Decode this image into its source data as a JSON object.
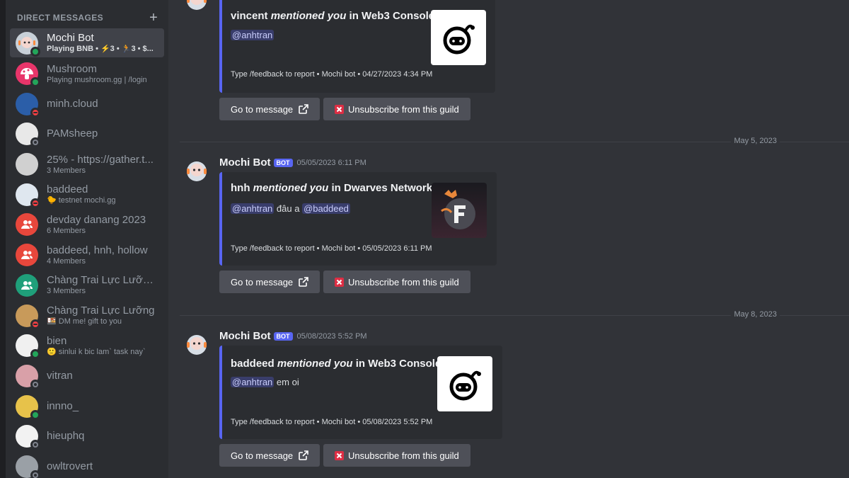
{
  "sidebar": {
    "header": "DIRECT MESSAGES",
    "items": [
      {
        "name": "Mochi Bot",
        "sub": "Playing BNB • ⚡3 • 🏃3 • $...",
        "status": "online",
        "avatar": "mochi-bot-avatar",
        "color": "#c8d0d8"
      },
      {
        "name": "Mushroom",
        "sub": "Playing mushroom.gg | /login",
        "status": "online",
        "avatar": "mushroom-avatar",
        "color": "#e8356a"
      },
      {
        "name": "minh.cloud",
        "sub": "",
        "status": "dnd",
        "avatar": "minh-avatar",
        "color": "#2b5ea8"
      },
      {
        "name": "PAMsheep",
        "sub": "",
        "status": "offline",
        "avatar": "pamsheep-avatar",
        "color": "#e8e8e8"
      },
      {
        "name": "25% - https://gather.t...",
        "sub": "3 Members",
        "status": "none",
        "avatar": "group-photo-avatar",
        "color": "#d0d0d0"
      },
      {
        "name": "baddeed",
        "sub": "🐤 testnet mochi.gg",
        "status": "dnd",
        "avatar": "baddeed-avatar",
        "color": "#dfe7ef"
      },
      {
        "name": "devday danang 2023",
        "sub": "6 Members",
        "status": "none",
        "avatar": "group-icon",
        "color": "#e8473c"
      },
      {
        "name": "baddeed, hnh, hollow",
        "sub": "4 Members",
        "status": "none",
        "avatar": "group-icon",
        "color": "#e8473c"
      },
      {
        "name": "Chàng Trai Lực Lưỡng,...",
        "sub": "3 Members",
        "status": "none",
        "avatar": "group-icon",
        "color": "#1f9f7a"
      },
      {
        "name": "Chàng Trai Lực Lưỡng",
        "sub": "🍱 DM me! gift to you",
        "status": "dnd",
        "avatar": "doge-avatar",
        "color": "#c89a5a"
      },
      {
        "name": "bien",
        "sub": "🙂 sinlui k bic lam` task nay`",
        "status": "online",
        "avatar": "bien-avatar",
        "color": "#f0f0f0"
      },
      {
        "name": "vitran",
        "sub": "",
        "status": "offline",
        "avatar": "vitran-avatar",
        "color": "#d9a0a8"
      },
      {
        "name": "innno_",
        "sub": "",
        "status": "online",
        "avatar": "innno-avatar",
        "color": "#e7c24a"
      },
      {
        "name": "hieuphq",
        "sub": "",
        "status": "offline",
        "avatar": "hieuphq-avatar",
        "color": "#f2f2f2"
      },
      {
        "name": "owltrovert",
        "sub": "",
        "status": "offline",
        "avatar": "owl-avatar",
        "color": "#9aa0a6"
      }
    ]
  },
  "messages": [
    {
      "show_head": false,
      "embed": {
        "actor": "vincent",
        "mentioned": "mentioned you",
        "in": "in",
        "guild": "Web3 Console",
        "desc_mentions": [
          "@anhtran"
        ],
        "desc_text": "",
        "footer": "Type /feedback to report • Mochi bot • 04/27/2023 4:34 PM",
        "thumb": "web3-console-logo"
      },
      "buttons": {
        "go": "Go to message",
        "unsub": "Unsubscribe from this guild"
      }
    },
    {
      "date": "May 5, 2023",
      "show_head": true,
      "author": "Mochi Bot",
      "tag": "BOT",
      "time": "05/05/2023 6:11 PM",
      "embed": {
        "actor": "hnh",
        "mentioned": "mentioned you",
        "in": "in",
        "guild": "Dwarves Network",
        "desc_mentions": [
          "@anhtran",
          "@baddeed"
        ],
        "desc_text": "đâu a",
        "footer": "Type /feedback to report • Mochi bot • 05/05/2023 6:11 PM",
        "thumb": "dwarves-network-logo"
      },
      "buttons": {
        "go": "Go to message",
        "unsub": "Unsubscribe from this guild"
      }
    },
    {
      "date": "May 8, 2023",
      "show_head": true,
      "author": "Mochi Bot",
      "tag": "BOT",
      "time": "05/08/2023 5:52 PM",
      "embed": {
        "actor": "baddeed",
        "mentioned": "mentioned you",
        "in": "in",
        "guild": "Web3 Console",
        "desc_mentions": [
          "@anhtran"
        ],
        "desc_text": "em oi",
        "footer": "Type /feedback to report • Mochi bot • 05/08/2023 5:52 PM",
        "thumb": "web3-console-logo"
      },
      "buttons": {
        "go": "Go to message",
        "unsub": "Unsubscribe from this guild"
      }
    }
  ],
  "colors": {
    "accent": "#5865f2",
    "online": "#23a55a",
    "dnd": "#f23f43"
  }
}
